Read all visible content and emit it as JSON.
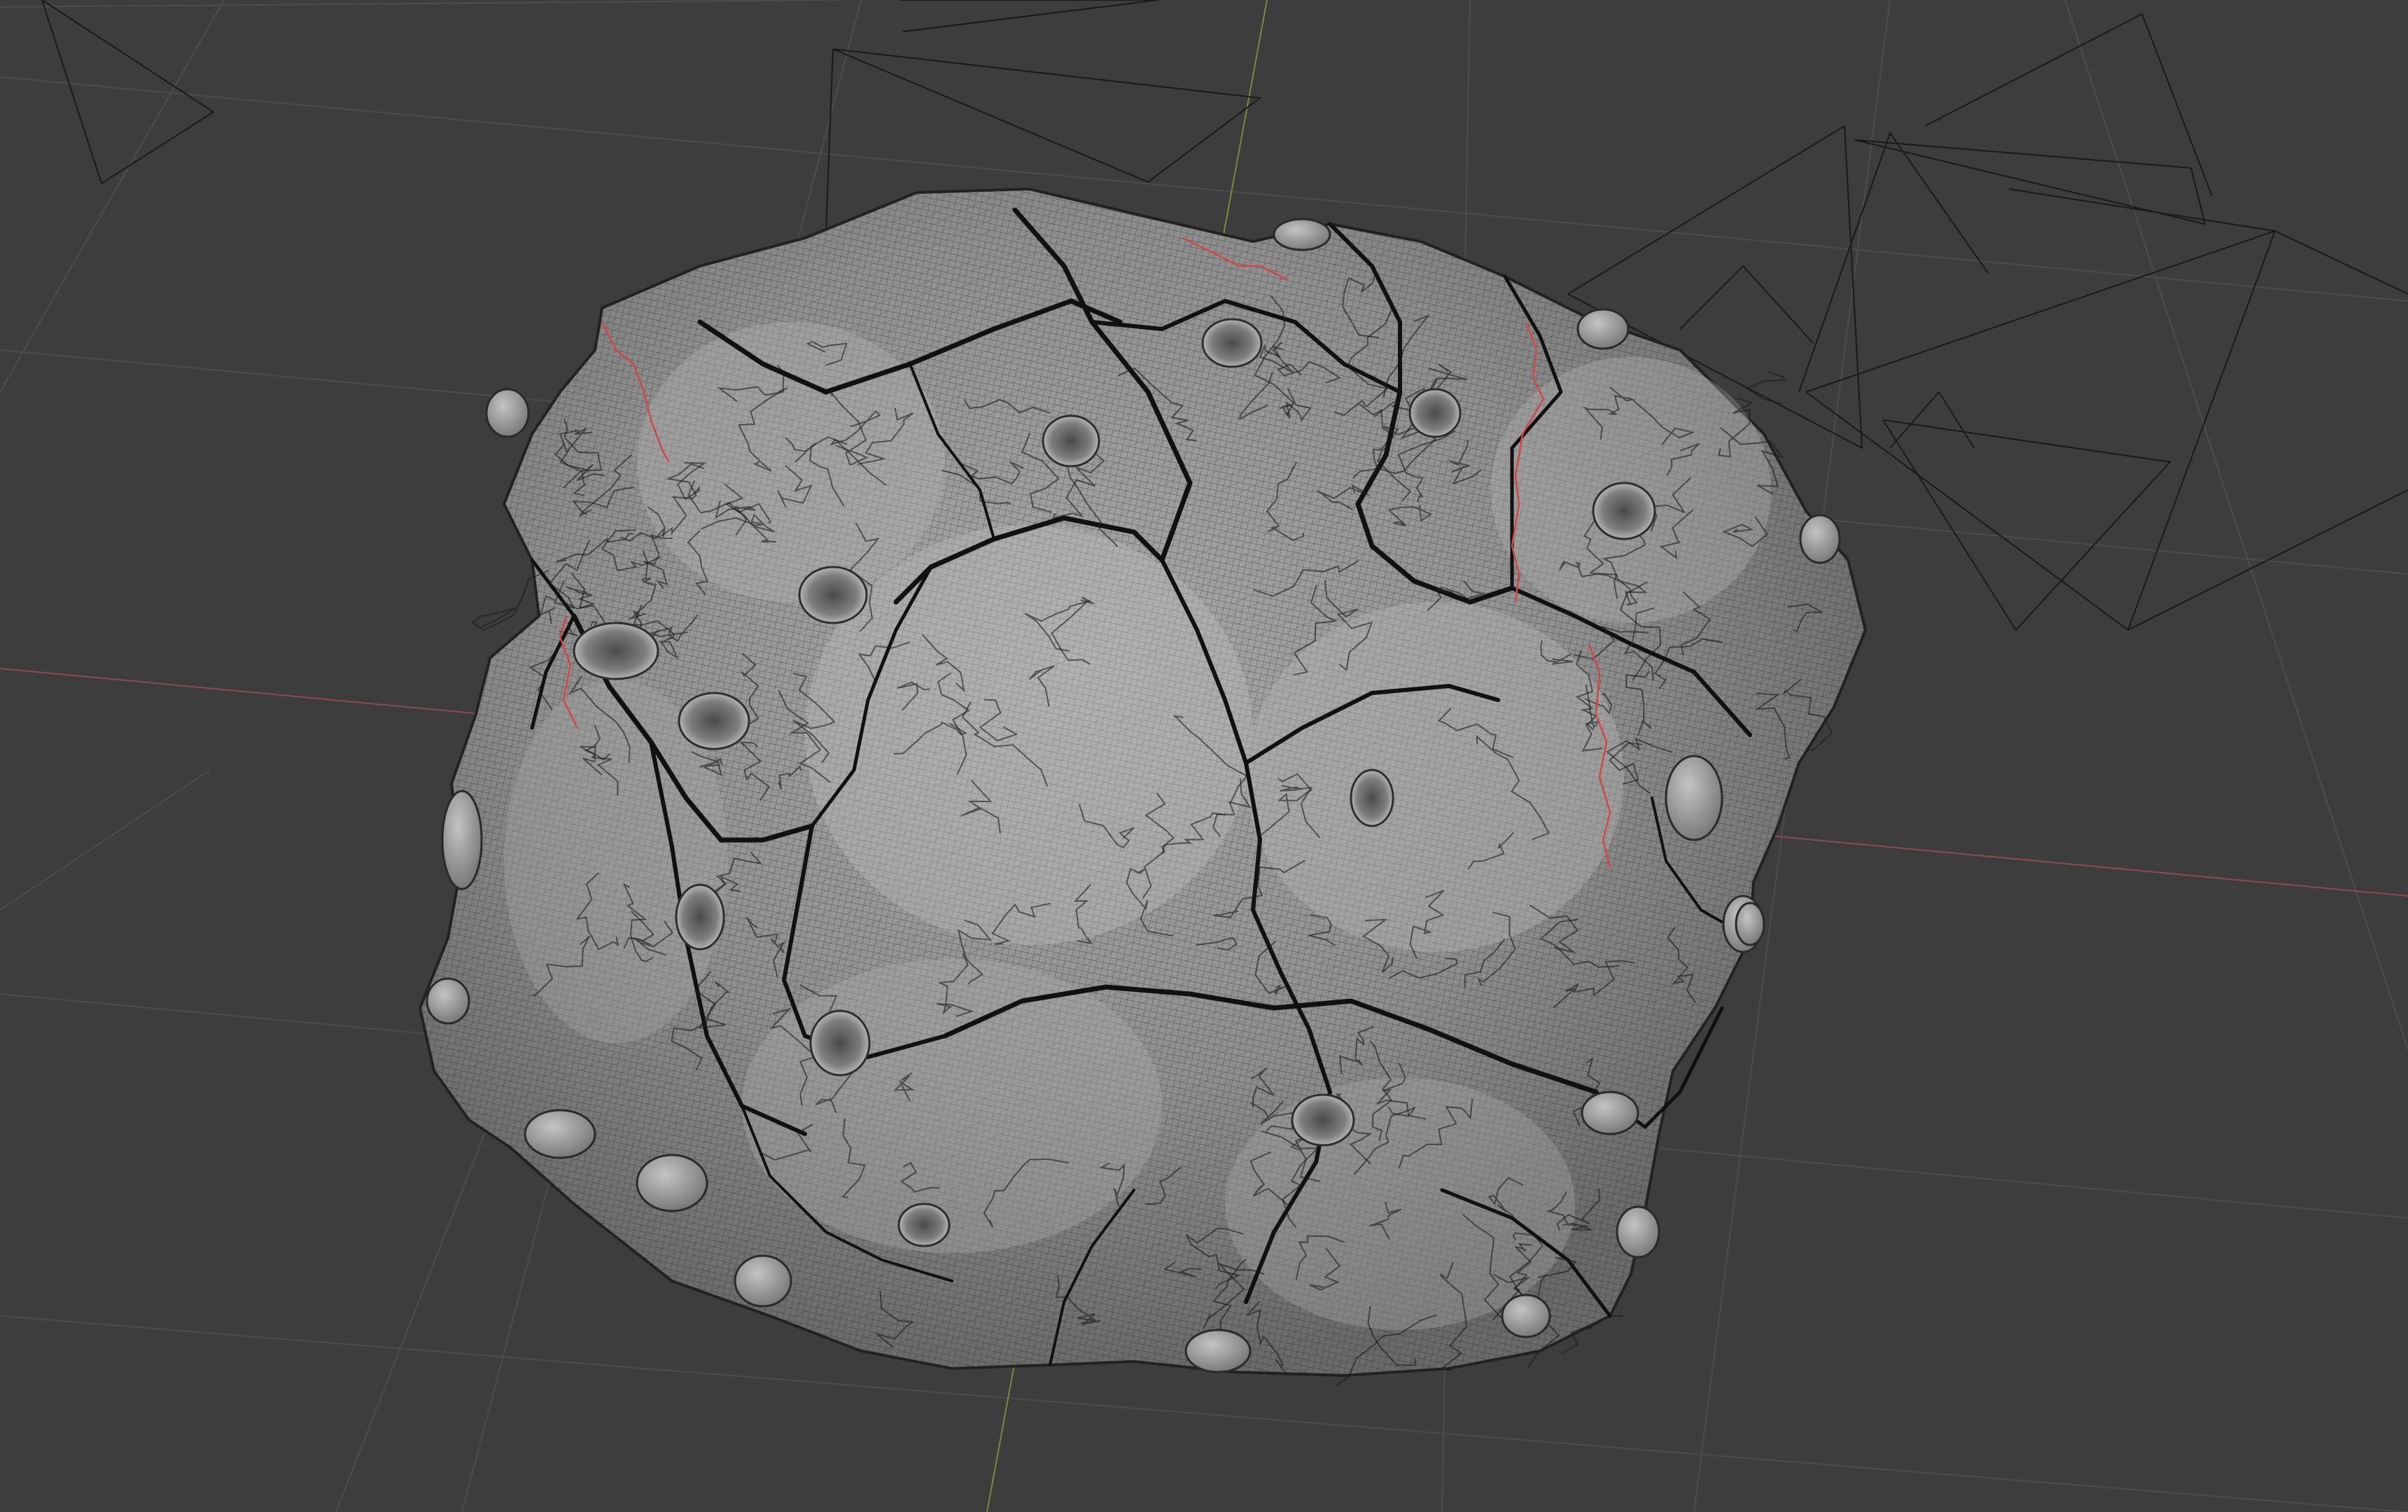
{
  "viewport": {
    "mode": "3d-viewport",
    "object": "rock-mesh",
    "display": "wireframe-overlay",
    "shading": "solid"
  },
  "colors": {
    "background": "#3d3d3d",
    "grid_line": "#4c4c4c",
    "x_axis": "#8c4a55",
    "y_axis": "#7c8a3c",
    "camera_frame": "#1a1a1a",
    "mesh_base": "#8f8f8f",
    "mesh_light": "#a9a9a9",
    "mesh_shadow": "#5a5a5a",
    "wire": "#1e1e1e",
    "seam": "#d04848"
  },
  "icons": {
    "scene_object": "rock-mesh-icon",
    "camera_frames": "camera-frame-icon"
  }
}
